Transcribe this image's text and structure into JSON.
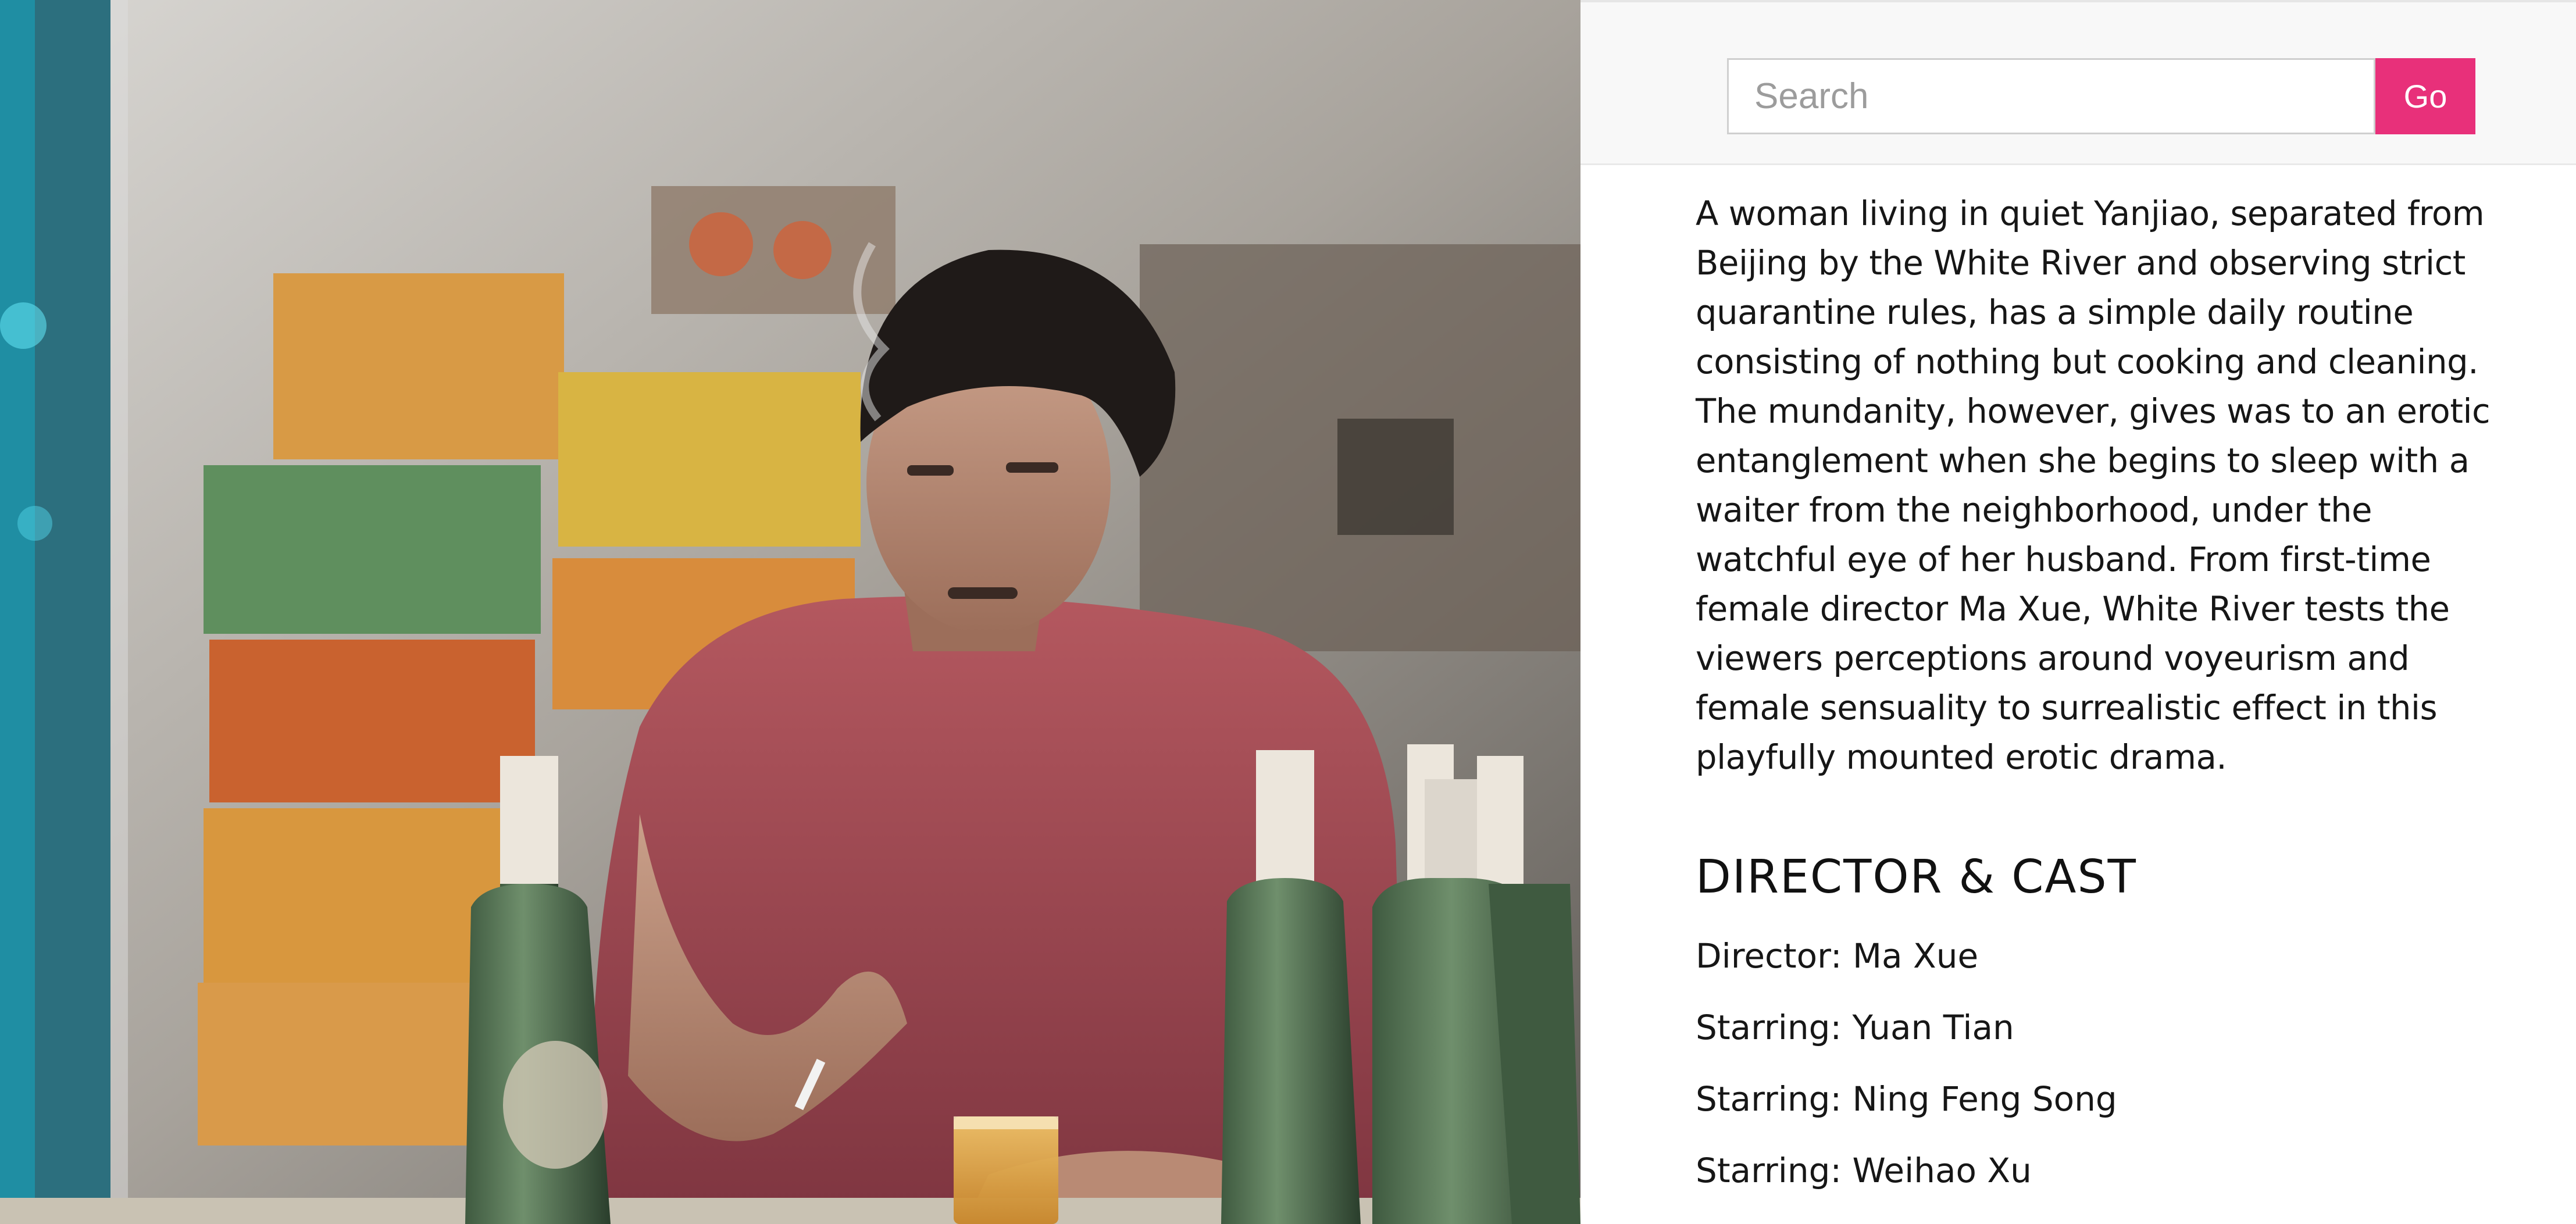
{
  "hero": {
    "image_alt": "Film still: a man in a red t-shirt smoking at a table with beer bottles"
  },
  "search": {
    "placeholder": "Search",
    "value": "",
    "button_label": "Go"
  },
  "synopsis": {
    "lines": [
      "A woman living in quiet Yanjiao, separated from",
      "Beijing by the White River and observing strict",
      "quarantine rules, has a simple daily routine",
      "consisting of nothing but cooking and cleaning.",
      "The mundanity, however, gives was to an erotic",
      "entanglement when she begins to sleep with a",
      "waiter from the neighborhood, under the",
      "watchful eye of her husband. From first-time",
      "female director Ma Xue, White River tests the",
      "viewers perceptions around voyeurism and",
      "female sensuality to surrealistic effect in this",
      "playfully mounted erotic drama."
    ]
  },
  "director_cast": {
    "title": "DIRECTOR & CAST",
    "items": [
      {
        "text": "Director: Ma Xue"
      },
      {
        "text": "Starring: Yuan Tian"
      },
      {
        "text": "Starring: Ning Feng Song"
      },
      {
        "text": "Starring: Weihao Xu"
      }
    ]
  },
  "colors": {
    "accent": "#e8307a",
    "text": "#161616",
    "topbar_bg": "#f8f8f8"
  }
}
